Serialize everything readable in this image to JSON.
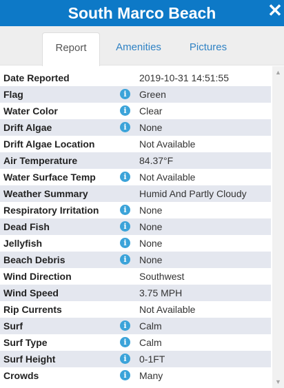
{
  "header": {
    "title": "South Marco Beach",
    "close_icon": "close-icon"
  },
  "tabs": [
    {
      "label": "Report",
      "active": true
    },
    {
      "label": "Amenities",
      "active": false
    },
    {
      "label": "Pictures",
      "active": false
    }
  ],
  "report": {
    "rows": [
      {
        "label": "Date Reported",
        "value": "2019-10-31 14:51:55",
        "info": false
      },
      {
        "label": "Flag",
        "value": "Green",
        "info": true
      },
      {
        "label": "Water Color",
        "value": "Clear",
        "info": true
      },
      {
        "label": "Drift Algae",
        "value": "None",
        "info": true
      },
      {
        "label": "Drift Algae Location",
        "value": "Not Available",
        "info": false
      },
      {
        "label": "Air Temperature",
        "value": "84.37°F",
        "info": false
      },
      {
        "label": "Water Surface Temp",
        "value": "Not Available",
        "info": true
      },
      {
        "label": "Weather Summary",
        "value": "Humid And Partly Cloudy",
        "info": false
      },
      {
        "label": "Respiratory Irritation",
        "value": "None",
        "info": true
      },
      {
        "label": "Dead Fish",
        "value": "None",
        "info": true
      },
      {
        "label": "Jellyfish",
        "value": "None",
        "info": true
      },
      {
        "label": "Beach Debris",
        "value": "None",
        "info": true
      },
      {
        "label": "Wind Direction",
        "value": "Southwest",
        "info": false
      },
      {
        "label": "Wind Speed",
        "value": "3.75 MPH",
        "info": false
      },
      {
        "label": "Rip Currents",
        "value": "Not Available",
        "info": false
      },
      {
        "label": "Surf",
        "value": "Calm",
        "info": true
      },
      {
        "label": "Surf Type",
        "value": "Calm",
        "info": true
      },
      {
        "label": "Surf Height",
        "value": "0-1FT",
        "info": true
      },
      {
        "label": "Crowds",
        "value": "Many",
        "info": true
      }
    ]
  },
  "info_glyph": "i",
  "colors": {
    "header_bg": "#0d79c7",
    "tab_link": "#2f82c4",
    "row_alt": "#e4e7ef",
    "info_icon": "#3ba3d9"
  }
}
